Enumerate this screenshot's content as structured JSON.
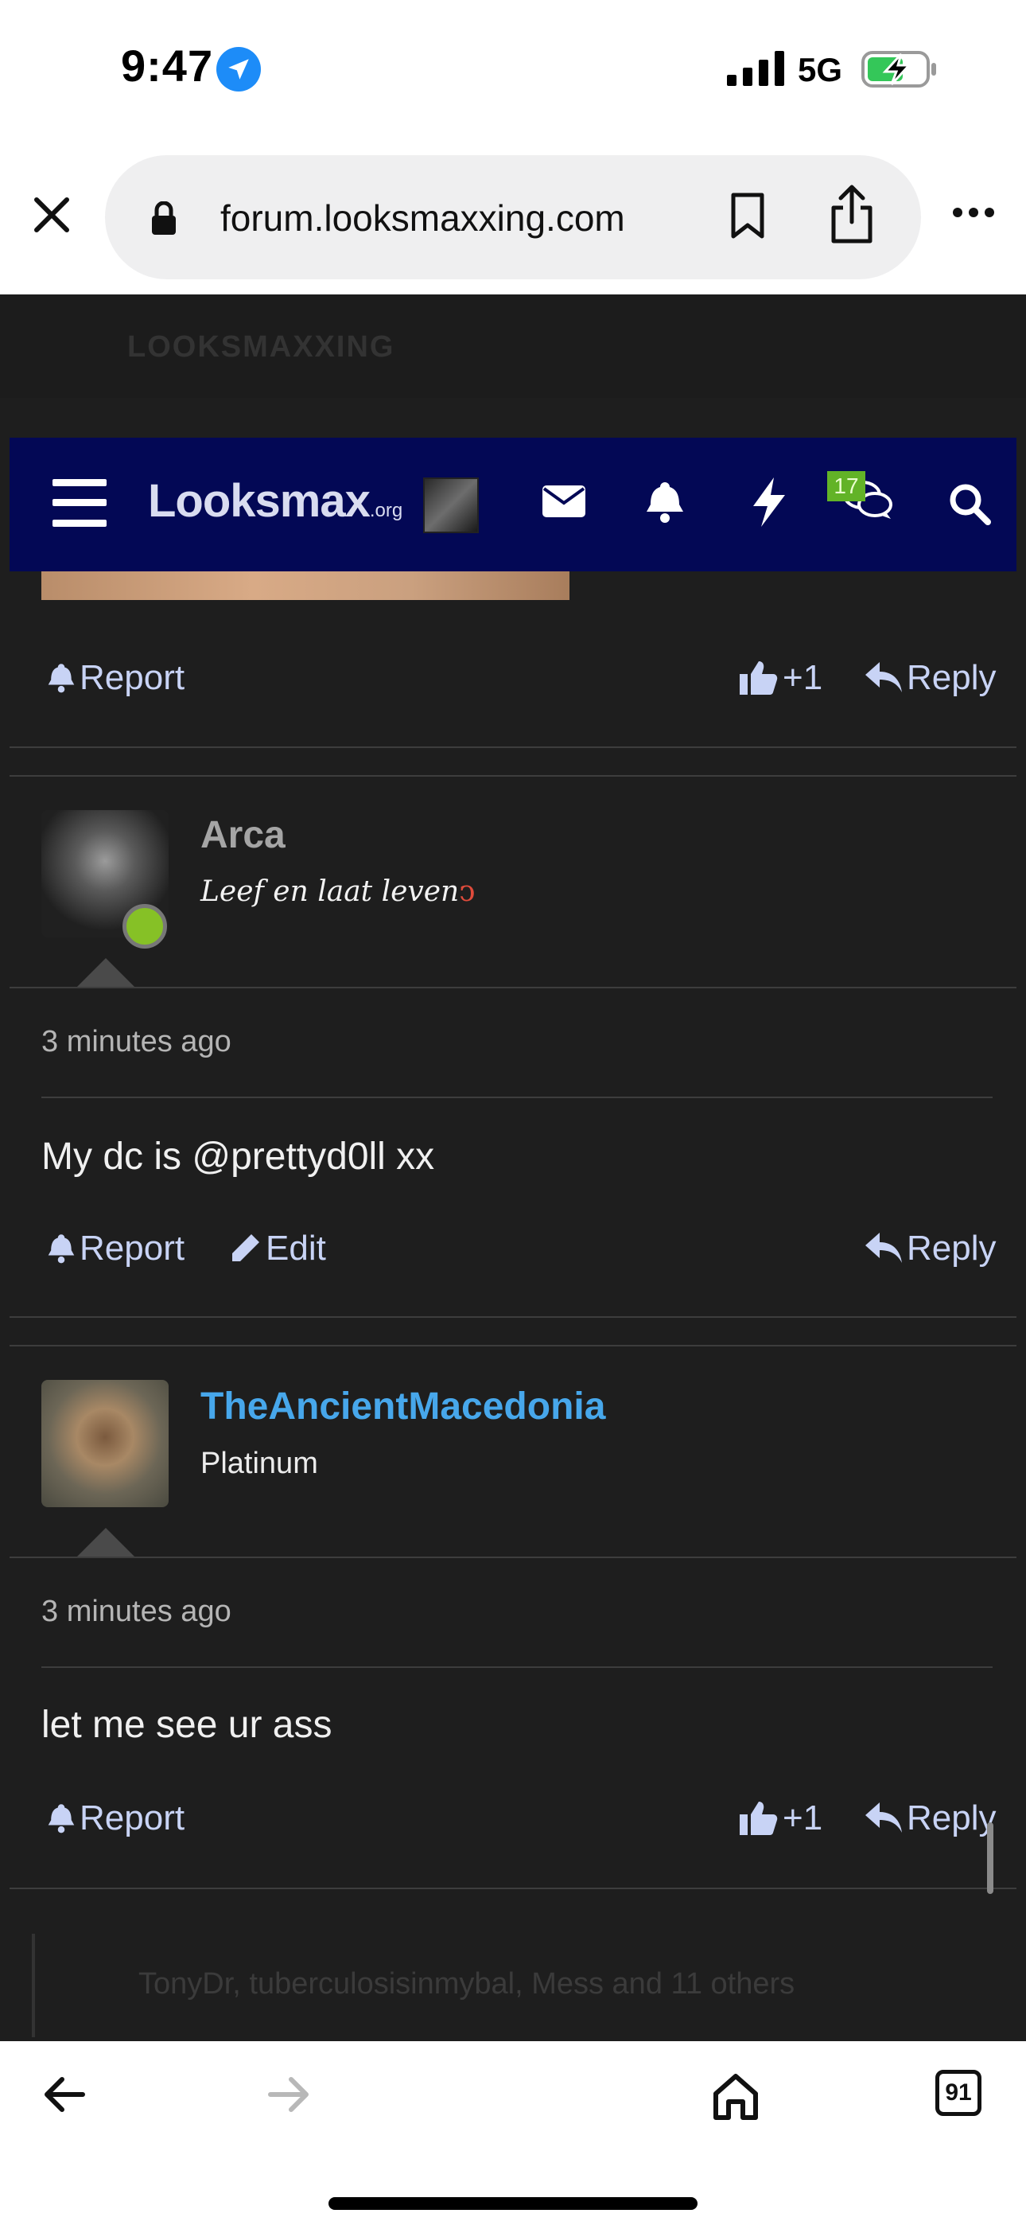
{
  "status_bar": {
    "time": "9:47",
    "network": "5G"
  },
  "browser": {
    "url": "forum.looksmaxxing.com",
    "tab_count": "91"
  },
  "ghost_header": {
    "title": "LOOKSMAXXING"
  },
  "site_header": {
    "logo": "Looksmax",
    "logo_suffix": ".org",
    "chat_badge": "17"
  },
  "actions": {
    "report": "Report",
    "edit": "Edit",
    "reply": "Reply",
    "plus_one": "+1"
  },
  "posts": [
    {
      "username": "Arca",
      "signature": "Leef en laat leven",
      "time": "3 minutes ago",
      "body": "My dc is @prettyd0ll xx"
    },
    {
      "username": "TheAncientMacedonia",
      "user_title": "Platinum",
      "time": "3 minutes ago",
      "body": "let me see ur ass"
    }
  ],
  "footer_reactions": "TonyDr, tuberculosisinmybal, Mess and 11 others",
  "colors": {
    "header_bg": "#030855",
    "content_bg": "#1e1e1e",
    "link": "#47a7eb",
    "badge": "#62b327",
    "online": "#86c126"
  }
}
